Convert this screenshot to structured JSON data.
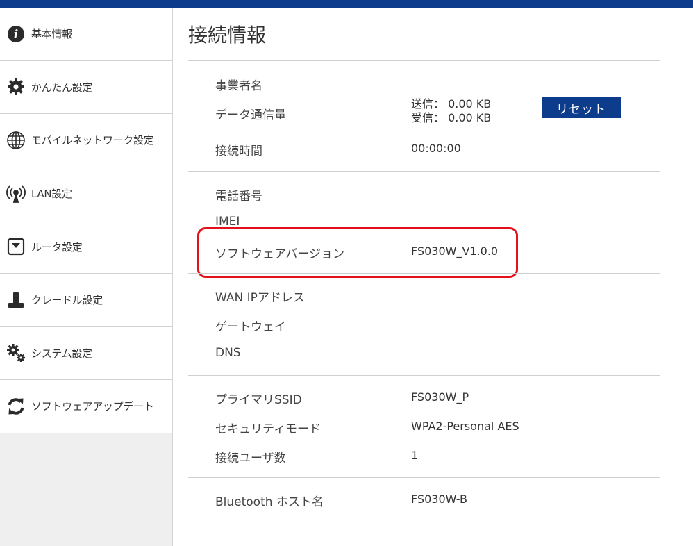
{
  "colors": {
    "accent": "#0d3c8c",
    "highlight": "#e3121a",
    "sidebar_bg": "#efefef"
  },
  "sidebar": {
    "items": [
      {
        "label": "基本情報",
        "icon": "info-icon"
      },
      {
        "label": "かんたん設定",
        "icon": "gear-icon"
      },
      {
        "label": "モバイルネットワーク設定",
        "icon": "globe-icon"
      },
      {
        "label": "LAN設定",
        "icon": "antenna-icon"
      },
      {
        "label": "ルータ設定",
        "icon": "router-icon"
      },
      {
        "label": "クレードル設定",
        "icon": "cradle-icon"
      },
      {
        "label": "システム設定",
        "icon": "gears-icon"
      },
      {
        "label": "ソフトウェアアップデート",
        "icon": "refresh-icon"
      }
    ]
  },
  "main": {
    "title": "接続情報",
    "sections": {
      "carrier": {
        "label": "事業者名"
      },
      "data_usage": {
        "label": "データ通信量",
        "sent": "送信： 0.00 KB",
        "received": "受信： 0.00 KB",
        "reset_label": "リセット"
      },
      "connection_time": {
        "label": "接続時間",
        "value": "00:00:00"
      },
      "phone": {
        "label": "電話番号"
      },
      "imei": {
        "label": "IMEI"
      },
      "software_version": {
        "label": "ソフトウェアバージョン",
        "value": "FS030W_V1.0.0"
      },
      "wan_ip": {
        "label": "WAN IPアドレス"
      },
      "gateway": {
        "label": "ゲートウェイ"
      },
      "dns": {
        "label": "DNS"
      },
      "primary_ssid": {
        "label": "プライマリSSID",
        "value": "FS030W_P"
      },
      "security_mode": {
        "label": "セキュリティモード",
        "value": "WPA2-Personal AES"
      },
      "connected_users": {
        "label": "接続ユーザ数",
        "value": "1"
      },
      "bluetooth": {
        "label": "Bluetooth ホスト名",
        "value": "FS030W-B"
      }
    }
  }
}
